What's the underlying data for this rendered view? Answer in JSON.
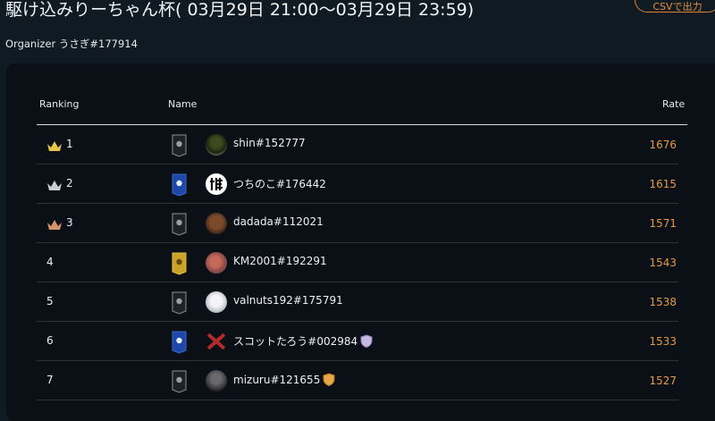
{
  "header": {
    "title": "駆け込みりーちゃん杯( 03月29日 21:00〜03月29日 23:59)",
    "csv_button": "CSVで出力",
    "organizer_label": "Organizer",
    "organizer_name": "うさぎ#177914"
  },
  "table": {
    "columns": [
      "Ranking",
      "Name",
      "Rate"
    ],
    "rows": [
      {
        "rank": "1",
        "crown": "gold",
        "banner": "dark",
        "avatar": "green-mountain",
        "name": "shin#152777",
        "badge": "",
        "rate": "1676"
      },
      {
        "rank": "2",
        "crown": "silver",
        "banner": "blue",
        "avatar": "kanji-white",
        "name": "つちのこ#176442",
        "badge": "",
        "rate": "1615"
      },
      {
        "rank": "3",
        "crown": "bronze",
        "banner": "dark",
        "avatar": "brown-portrait",
        "name": "dadada#112021",
        "badge": "",
        "rate": "1571"
      },
      {
        "rank": "4",
        "crown": "",
        "banner": "gold",
        "avatar": "red-blossom",
        "name": "KM2001#192291",
        "badge": "",
        "rate": "1543"
      },
      {
        "rank": "5",
        "crown": "",
        "banner": "dark",
        "avatar": "anime-light",
        "name": "valnuts192#175791",
        "badge": "",
        "rate": "1538"
      },
      {
        "rank": "6",
        "crown": "",
        "banner": "blue",
        "avatar": "red-x",
        "name": "スコットたろう#002984",
        "badge": "silver-shield",
        "rate": "1533"
      },
      {
        "rank": "7",
        "crown": "",
        "banner": "dark",
        "avatar": "dark-portrait",
        "name": "mizuru#121655",
        "badge": "gold-shield",
        "rate": "1527"
      }
    ]
  },
  "colors": {
    "background": "#0f1a22",
    "panel": "#0a1015",
    "rate": "#e39a45",
    "accent_button": "#e39040"
  }
}
